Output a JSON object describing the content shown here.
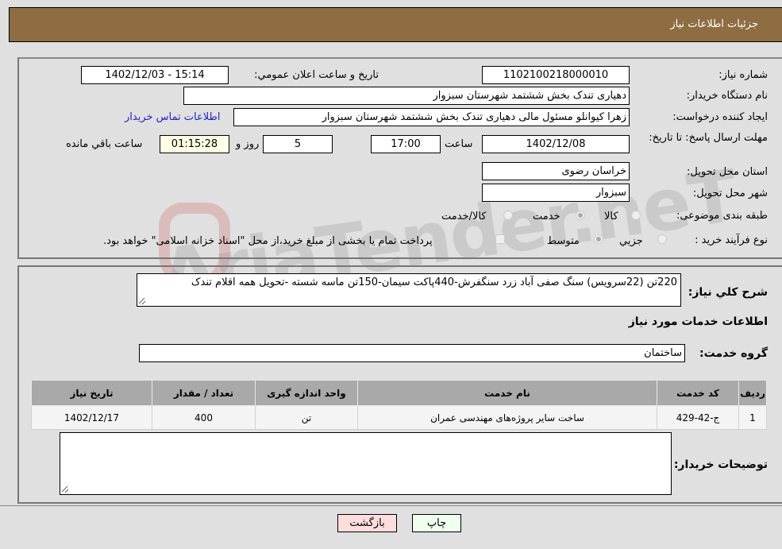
{
  "header": {
    "title": "جزئیات اطلاعات نیاز"
  },
  "form": {
    "need_number_label": "شماره نیاز:",
    "need_number": "1102100218000010",
    "announce_label": "تاریخ و ساعت اعلان عمومي:",
    "announce_value": "1402/12/03 - 15:14",
    "buyer_org_label": "نام دستگاه خریدار:",
    "buyer_org": "دهیاری تندک بخش ششتمد شهرستان سبزوار",
    "creator_label": "ایجاد کننده درخواست:",
    "creator": "زهرا کیوانلو مسئول مالی دهیاری تندک بخش ششتمد شهرستان سبزوار",
    "contact_link": "اطلاعات تماس خریدار",
    "deadline_label": "مهلت ارسال پاسخ: تا تاریخ:",
    "deadline_date": "1402/12/08",
    "time_label": "ساعت",
    "deadline_time": "17:00",
    "days_value": "5",
    "days_label": "روز و",
    "remaining_time": "01:15:28",
    "remaining_label": "ساعت باقي مانده",
    "province_label": "استان محل تحویل:",
    "province": "خراسان رضوی",
    "city_label": "شهر محل تحویل:",
    "city": "سبزوار",
    "category_label": "طبقه بندی موضوعی:",
    "category_options": [
      "کالا",
      "خدمت",
      "کالا/خدمت"
    ],
    "category_selected": "خدمت",
    "process_label": "نوع فرآیند خرید :",
    "process_options": [
      "جزيي",
      "متوسط"
    ],
    "process_selected": "متوسط",
    "treasury_note": "پرداخت تمام یا بخشی از مبلغ خرید،از محل \"اسناد خزانه اسلامی\" خواهد بود."
  },
  "details": {
    "description_label": "شرح کلي نیاز:",
    "description": "220تن (22سرویس)  سنگ صفی آباد زرد سنگفرش-440پاکت سیمان-150تن ماسه شسته -تحویل همه اقلام تندک",
    "services_heading": "اطلاعات خدمات مورد نیاز",
    "service_group_label": "گروه خدمت:",
    "service_group": "ساختمان",
    "table": {
      "headers": [
        "ردیف",
        "کد خدمت",
        "نام خدمت",
        "واحد اندازه گیری",
        "تعداد / مقدار",
        "تاریخ نیاز"
      ],
      "rows": [
        [
          "1",
          "ج-42-429",
          "ساخت سایر پروژه‌های مهندسی عمران",
          "تن",
          "400",
          "1402/12/17"
        ]
      ]
    },
    "buyer_notes_label": "توضیحات خریدار:",
    "buyer_notes": ""
  },
  "buttons": {
    "print": "چاپ",
    "back": "بازگشت"
  },
  "watermark": "AriaTender.neT",
  "colors": {
    "header_bg": "#8e6d42",
    "print_bg": "#eeffee",
    "back_bg": "#ffdddd",
    "link": "#2222cc"
  }
}
